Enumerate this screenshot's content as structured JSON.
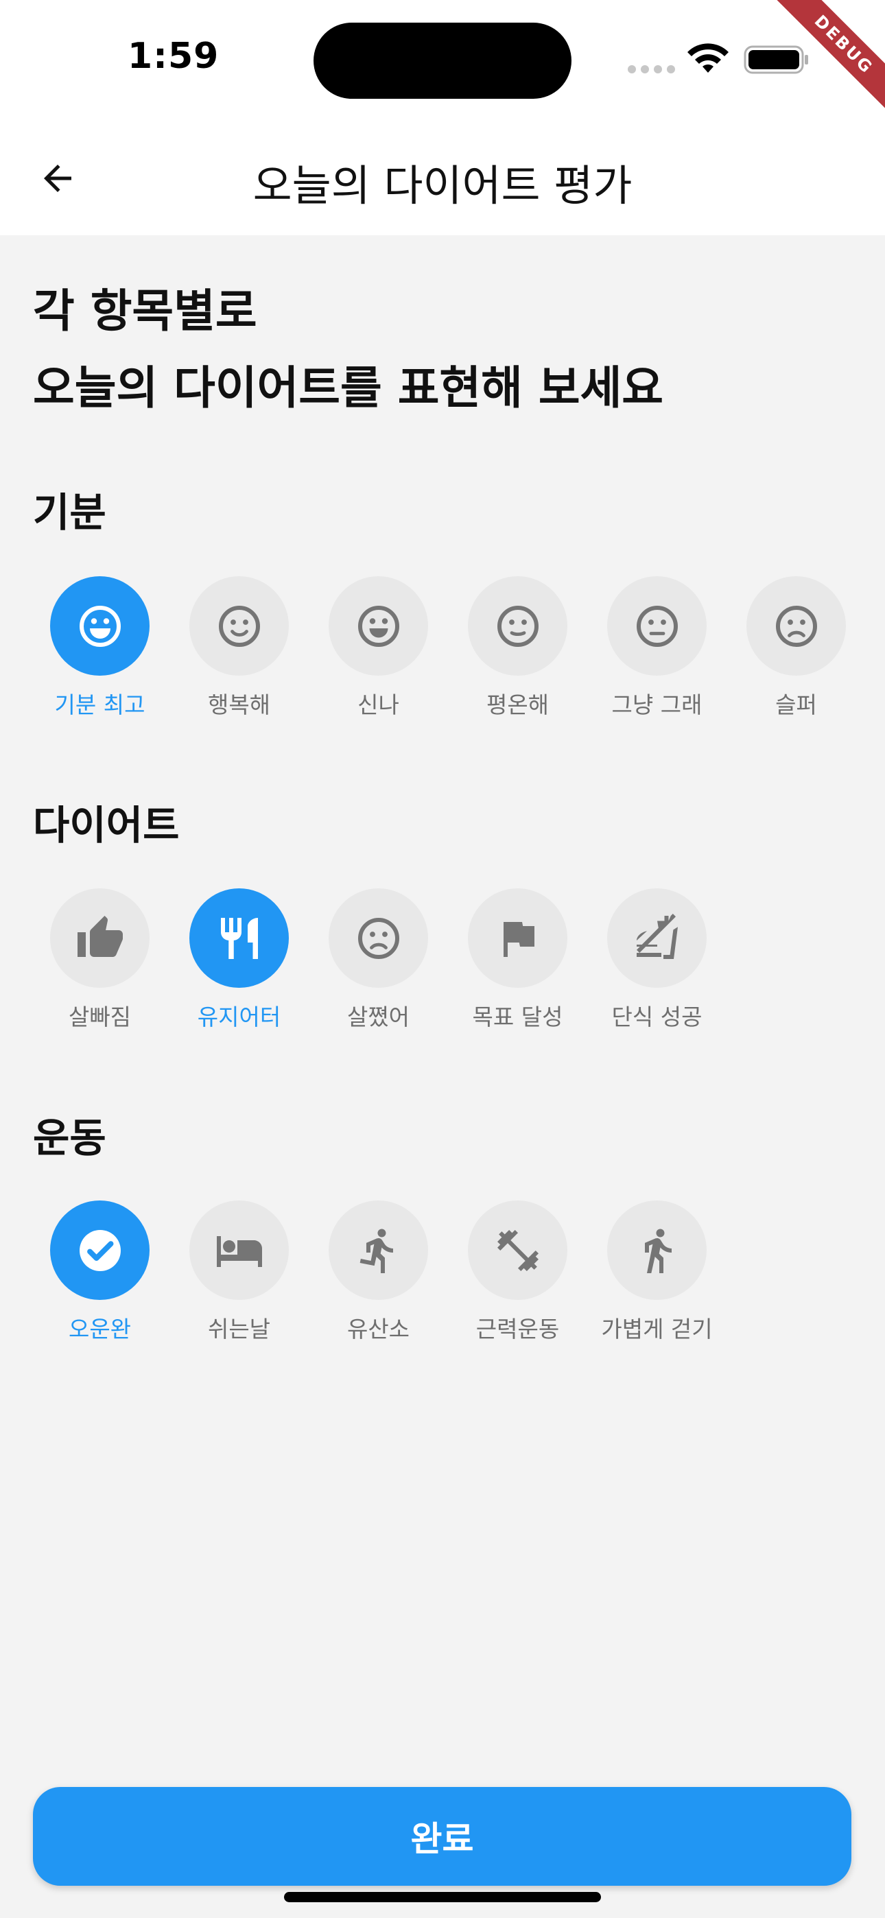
{
  "status_bar": {
    "time": "1:59",
    "debug_label": "DEBUG"
  },
  "app_bar": {
    "back_icon": "arrow-left-icon",
    "title": "오늘의 다이어트 평가"
  },
  "headline": {
    "line1": "각 항목별로",
    "line2": "오늘의 다이어트를 표현해 보세요"
  },
  "sections": [
    {
      "title": "기분",
      "options": [
        {
          "label": "기분 최고",
          "icon": "very-happy-face-icon",
          "selected": true
        },
        {
          "label": "행복해",
          "icon": "smile-face-icon",
          "selected": false
        },
        {
          "label": "신나",
          "icon": "grin-face-icon",
          "selected": false
        },
        {
          "label": "평온해",
          "icon": "neutral-face-icon",
          "selected": false
        },
        {
          "label": "그냥 그래",
          "icon": "meh-face-icon",
          "selected": false
        },
        {
          "label": "슬퍼",
          "icon": "sad-face-icon",
          "selected": false
        }
      ]
    },
    {
      "title": "다이어트",
      "options": [
        {
          "label": "살빠짐",
          "icon": "thumb-up-icon",
          "selected": false
        },
        {
          "label": "유지어터",
          "icon": "restaurant-icon",
          "selected": true
        },
        {
          "label": "살쪘어",
          "icon": "frown-face-icon",
          "selected": false
        },
        {
          "label": "목표 달성",
          "icon": "flag-icon",
          "selected": false
        },
        {
          "label": "단식 성공",
          "icon": "no-food-icon",
          "selected": false
        }
      ]
    },
    {
      "title": "운동",
      "options": [
        {
          "label": "오운완",
          "icon": "check-circle-icon",
          "selected": true
        },
        {
          "label": "쉬는날",
          "icon": "bed-icon",
          "selected": false
        },
        {
          "label": "유산소",
          "icon": "running-icon",
          "selected": false
        },
        {
          "label": "근력운동",
          "icon": "dumbbell-icon",
          "selected": false
        },
        {
          "label": "가볍게 걷기",
          "icon": "walking-icon",
          "selected": false
        }
      ]
    }
  ],
  "footer": {
    "done_label": "완료"
  },
  "colors": {
    "accent": "#2196f3",
    "unselected_circle": "#e8e8e8",
    "unselected_icon": "#757575",
    "label_gray": "#6e6e6e",
    "background": "#f3f3f3"
  }
}
